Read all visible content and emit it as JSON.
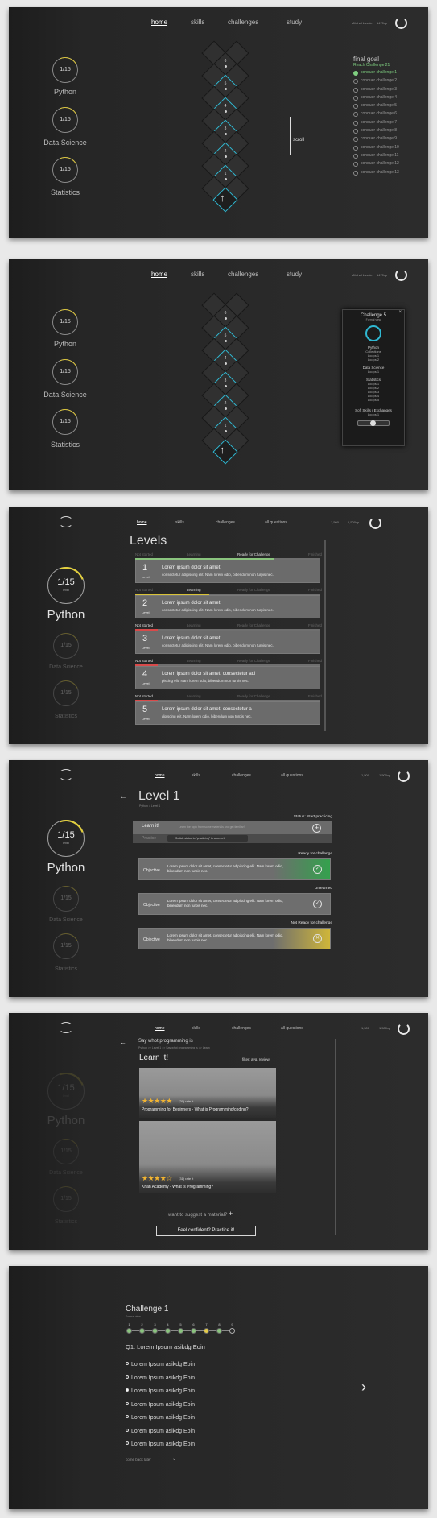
{
  "nav": {
    "home": "home",
    "skills": "skills",
    "challenges": "challenges",
    "study": "study",
    "all_questions": "all questions"
  },
  "user": {
    "name": "Mitchel Lavoie",
    "score": "1470xp",
    "name3": "1,500",
    "score3": "1,500xp"
  },
  "skills": [
    {
      "count": "1/15",
      "name": "Python"
    },
    {
      "count": "1/15",
      "name": "Data Science"
    },
    {
      "count": "1/15",
      "name": "Statistics"
    }
  ],
  "levelsub": "level",
  "tower": {
    "labels": [
      "6",
      "5",
      "4",
      "3",
      "2",
      "1"
    ],
    "scroll": "scroll"
  },
  "goal": {
    "title": "final goal",
    "subtitle": "Reach Challenge 21",
    "items": [
      "conquer challenge 1",
      "conquer challenge 2",
      "conquer challenge 3",
      "conquer challenge 4",
      "conquer challenge 5",
      "conquer challenge 6",
      "conquer challenge 7",
      "conquer challenge 8",
      "conquer challenge 9",
      "conquer challenge 10",
      "conquer challenge 11",
      "conquer challenge 12",
      "conquer challenge 13"
    ]
  },
  "popup": {
    "title": "Challenge 5",
    "subtitle": "Formal view",
    "close": "×",
    "groups": [
      {
        "head": "Python",
        "items": [
          "Collections",
          "Loops 1",
          "Loops 2"
        ]
      },
      {
        "head": "Data Science",
        "items": [
          "Loops 1"
        ]
      },
      {
        "head": "Statistics",
        "items": [
          "Loops 1",
          "Loops 2",
          "Loops 3",
          "Loops 4",
          "Loops 5"
        ]
      }
    ],
    "footer": "Soft Skills / Exchanges",
    "footer2": "Loops 1"
  },
  "levels": {
    "title": "Levels",
    "tags": [
      "Not started",
      "Learning",
      "Ready for Challenge",
      "Finished"
    ],
    "rows": [
      {
        "num": "1",
        "level": "Level",
        "title": "Lorem ipsum dolor sit amet,",
        "desc": "consectetur adipiscing elit. Nam lorem odio, bibendum non turpis nec.",
        "status": 2,
        "color": "#8ac47e",
        "fill": 0.75
      },
      {
        "num": "2",
        "level": "Level",
        "title": "Lorem ipsum dolor sit amet,",
        "desc": "consectetur adipiscing elit. Nam lorem odio, bibendum non turpis nec.",
        "status": 1,
        "color": "#d8c238",
        "fill": 0.4
      },
      {
        "num": "3",
        "level": "Level",
        "title": "Lorem ipsum dolor sit amet,",
        "desc": "consectetur adipiscing elit. Nam lorem odio, bibendum non turpis nec.",
        "status": 0,
        "color": "#d84a4a",
        "fill": 0.12
      },
      {
        "num": "4",
        "level": "Level",
        "title": "Lorem ipsum dolor sit amet, consectetur adi",
        "desc": "piscing elit. Nam lorem odio, bibendum non turpis nec.",
        "status": 0,
        "color": "#d84a4a",
        "fill": 0.12
      },
      {
        "num": "5",
        "level": "Level",
        "title": "Lorem ipsum dolor sit amet, consectetur a",
        "desc": "dipiscing elit. Nam lorem odio, bibendum non turpis nec.",
        "status": 0,
        "color": "#d84a4a",
        "fill": 0.12
      }
    ]
  },
  "level1": {
    "back": "←",
    "title": "Level 1",
    "crumb": "Python > Level 1",
    "status": "Status: Start practicing",
    "learn_label": "Learn it!",
    "learn_hint": "Learn the topic from some materials and get familiar!",
    "practice_label": "Practice",
    "practice_hint": "Switch status to \"practicing\" to access it",
    "objectives": [
      {
        "label": "Objective",
        "text": "Lorem ipsum dolor sit amet, consectetur adipiscing elit. Nam lorem odio, bibendum non turpis nec.",
        "status": "Ready for challenge",
        "icon": "✓",
        "tint": "#34a14d"
      },
      {
        "label": "Objective",
        "text": "Lorem ipsum dolor sit amet, consectetur adipiscing elit. Nam lorem odio, bibendum non turpis nec.",
        "status": "Unlearned",
        "icon": "✓",
        "tint": ""
      },
      {
        "label": "Objective",
        "text": "Lorem ipsum dolor sit amet, consectetur adipiscing elit. Nam lorem odio, bibendum non turpis nec.",
        "status": "Not Ready for challenge",
        "icon": "✕",
        "tint": "#cfb63a"
      }
    ]
  },
  "learn": {
    "back": "←",
    "heading": "Say whot programming is",
    "crumb": "Python >> Level 1 >> Say whot programming is >> Learn",
    "title": "Learn it!",
    "filter": "filter: avg. review",
    "cards": [
      {
        "stars": "★★★★★",
        "rating": "(29) rate it",
        "title": "Programming for Beginners - What is Programming/coding?"
      },
      {
        "stars": "★★★★☆",
        "rating": "(31) rate it",
        "title": "Khan Academy - What is Programming?"
      }
    ],
    "suggest": "want to suggest a material?",
    "plus": "+",
    "practice_btn": "Feel confident? Practice it!"
  },
  "challenge": {
    "title": "Challenge 1",
    "subtitle": "Formal view",
    "steps": [
      "1",
      "2",
      "3",
      "4",
      "5",
      "6",
      "7",
      "8",
      "9"
    ],
    "question": "Q1. Lorem Ipsom asikdg  Eoin",
    "options": [
      "Lorem Ipsum asikdg  Eoin",
      "Lorem Ipsum asikdg  Eoin",
      "Lorem Ipsum asikdg  Eoin",
      "Lorem Ipsum asikdg  Eoin",
      "Lorem Ipsum asikdg  Eoin",
      "Lorem Ipsum asikdg  Eoin",
      "Lorem Ipsum asikdg  Eoin"
    ],
    "selected": 2,
    "come_back": "come back later",
    "next": "›"
  }
}
